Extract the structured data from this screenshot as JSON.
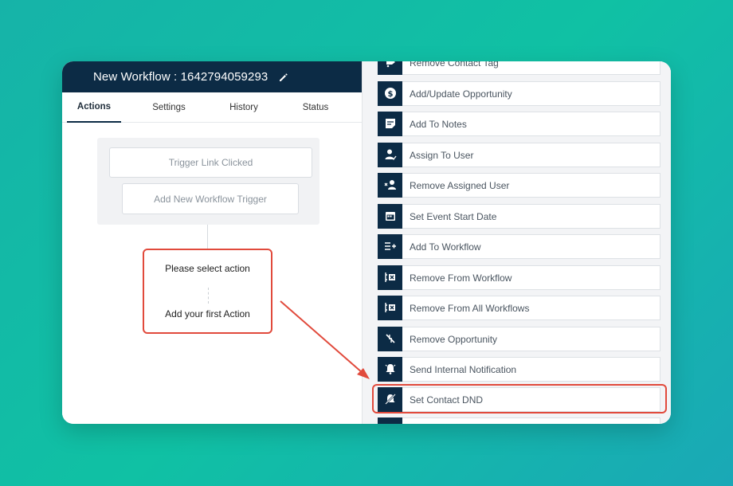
{
  "workflow": {
    "title": "New Workflow : 1642794059293"
  },
  "tabs": [
    {
      "label": "Actions",
      "active": true
    },
    {
      "label": "Settings",
      "active": false
    },
    {
      "label": "History",
      "active": false
    },
    {
      "label": "Status",
      "active": false
    }
  ],
  "triggers": {
    "trigger_label": "Trigger Link Clicked",
    "add_trigger_label": "Add New Workflow Trigger"
  },
  "action_box": {
    "select_label": "Please select action",
    "add_first_label": "Add your first Action"
  },
  "actions_list": [
    {
      "label": "Remove Contact Tag",
      "icon": "tag-remove-icon"
    },
    {
      "label": "Add/Update Opportunity",
      "icon": "dollar-icon"
    },
    {
      "label": "Add To Notes",
      "icon": "notes-icon"
    },
    {
      "label": "Assign To User",
      "icon": "user-assign-icon"
    },
    {
      "label": "Remove Assigned User",
      "icon": "user-remove-icon"
    },
    {
      "label": "Set Event Start Date",
      "icon": "calendar-icon"
    },
    {
      "label": "Add To Workflow",
      "icon": "list-add-icon"
    },
    {
      "label": "Remove From Workflow",
      "icon": "list-remove-icon"
    },
    {
      "label": "Remove From All Workflows",
      "icon": "list-remove-all-icon"
    },
    {
      "label": "Remove Opportunity",
      "icon": "opportunity-remove-icon"
    },
    {
      "label": "Send Internal Notification",
      "icon": "bell-icon"
    },
    {
      "label": "Set Contact DND",
      "icon": "bell-off-icon"
    }
  ],
  "colors": {
    "navy": "#0c2b45",
    "highlight_red": "#e14a3c",
    "background_teal": "#10c1a4"
  }
}
